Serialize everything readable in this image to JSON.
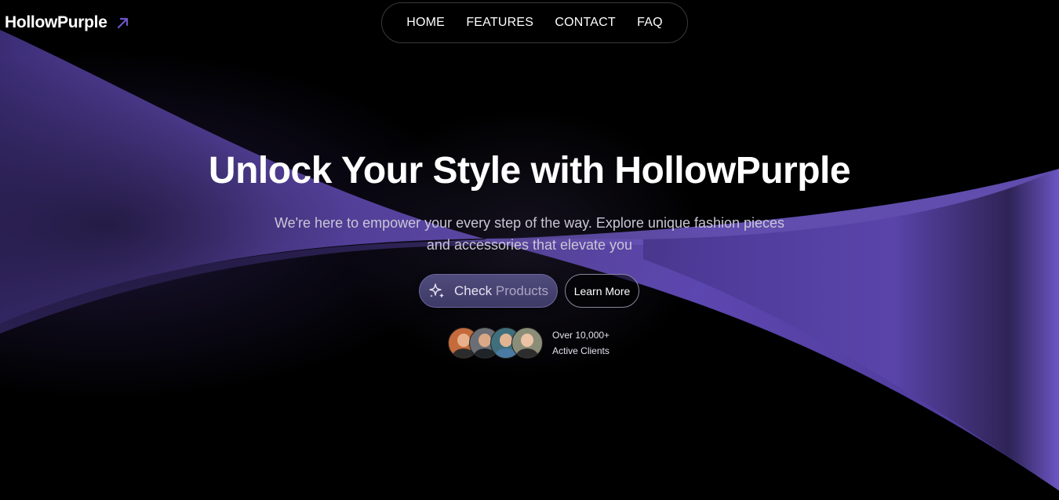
{
  "brand": {
    "name": "HollowPurple",
    "arrow_icon": "arrow-up-right-icon",
    "accent": "#6f56c6"
  },
  "nav": {
    "items": [
      {
        "label": "HOME"
      },
      {
        "label": "FEATURES"
      },
      {
        "label": "CONTACT"
      },
      {
        "label": "FAQ"
      }
    ]
  },
  "hero": {
    "title": "Unlock Your Style with HollowPurple",
    "subtitle": "We're here to empower your every step of the way. Explore unique fashion pieces and accessories that elevate you",
    "primary_button": {
      "label_a": "Check ",
      "label_b": "Products",
      "icon": "sparkles-icon"
    },
    "secondary_button": {
      "label": "Learn More"
    }
  },
  "social_proof": {
    "line1": "Over 10,000+",
    "line2": "Active Clients",
    "avatars": [
      {
        "bg": "#c56a3b",
        "skin": "#e8b08a",
        "shirt": "#2b2b2b"
      },
      {
        "bg": "#6b6e74",
        "skin": "#d9a987",
        "shirt": "#1f2428"
      },
      {
        "bg": "#3f6f7d",
        "skin": "#e2b493",
        "shirt": "#4a7aa3"
      },
      {
        "bg": "#8a8e78",
        "skin": "#ecc3a4",
        "shirt": "#2d2d2d"
      }
    ]
  },
  "colors": {
    "background": "#000000",
    "wave": "#6f56c6",
    "wave_dark": "#3a2d70"
  }
}
